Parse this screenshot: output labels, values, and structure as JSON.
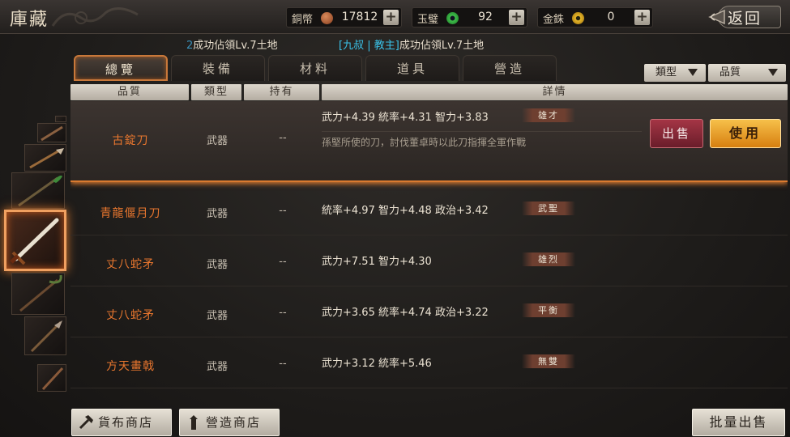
{
  "header": {
    "title": "庫藏",
    "back_label": "返回",
    "currencies": [
      {
        "label": "銅幣",
        "value": "17812",
        "icon": "copper-coin-icon",
        "color": "#a0522d"
      },
      {
        "label": "玉璧",
        "value": "92",
        "icon": "jade-icon",
        "color": "#3fbf4a"
      },
      {
        "label": "金銖",
        "value": "0",
        "icon": "gold-coin-icon",
        "color": "#d8a418"
      }
    ],
    "plus": "+"
  },
  "message": {
    "part1": "成功佔領Lv.7土地",
    "bracket_open": "[",
    "player": "九叔",
    "sep": " | ",
    "tag": "教主",
    "bracket_close": "]",
    "part2": "成功佔領Lv.7土地",
    "fragment": "2"
  },
  "tabs": [
    {
      "label": "總覽",
      "active": true
    },
    {
      "label": "裝備",
      "active": false
    },
    {
      "label": "材料",
      "active": false
    },
    {
      "label": "道具",
      "active": false
    },
    {
      "label": "營造",
      "active": false
    }
  ],
  "filters": {
    "type": "類型",
    "quality": "品質"
  },
  "columns": {
    "quality": "品質",
    "type": "類型",
    "held": "持有",
    "detail": "詳情"
  },
  "items": [
    {
      "name": "古錠刀",
      "type": "武器",
      "held": "--",
      "stats": "武力+4.39  統率+4.31  智力+3.83",
      "trait": "雄才",
      "desc": "孫堅所使的刀，討伐董卓時以此刀指揮全軍作戰",
      "selected": true
    },
    {
      "name": "青龍偃月刀",
      "type": "武器",
      "held": "--",
      "stats": "統率+4.97  智力+4.48  政治+3.42",
      "trait": "武聖"
    },
    {
      "name": "丈八蛇矛",
      "type": "武器",
      "held": "--",
      "stats": "武力+7.51  智力+4.30",
      "trait": "雄烈"
    },
    {
      "name": "丈八蛇矛",
      "type": "武器",
      "held": "--",
      "stats": "武力+3.65  統率+4.74  政治+3.22",
      "trait": "平衡"
    },
    {
      "name": "方天畫戟",
      "type": "武器",
      "held": "--",
      "stats": "武力+3.12  統率+5.46",
      "trait": "無雙"
    }
  ],
  "actions": {
    "sell": "出售",
    "use": "使用"
  },
  "bottom": {
    "currency_shop": "貨布商店",
    "build_shop": "營造商店",
    "bulk_sell": "批量出售"
  }
}
